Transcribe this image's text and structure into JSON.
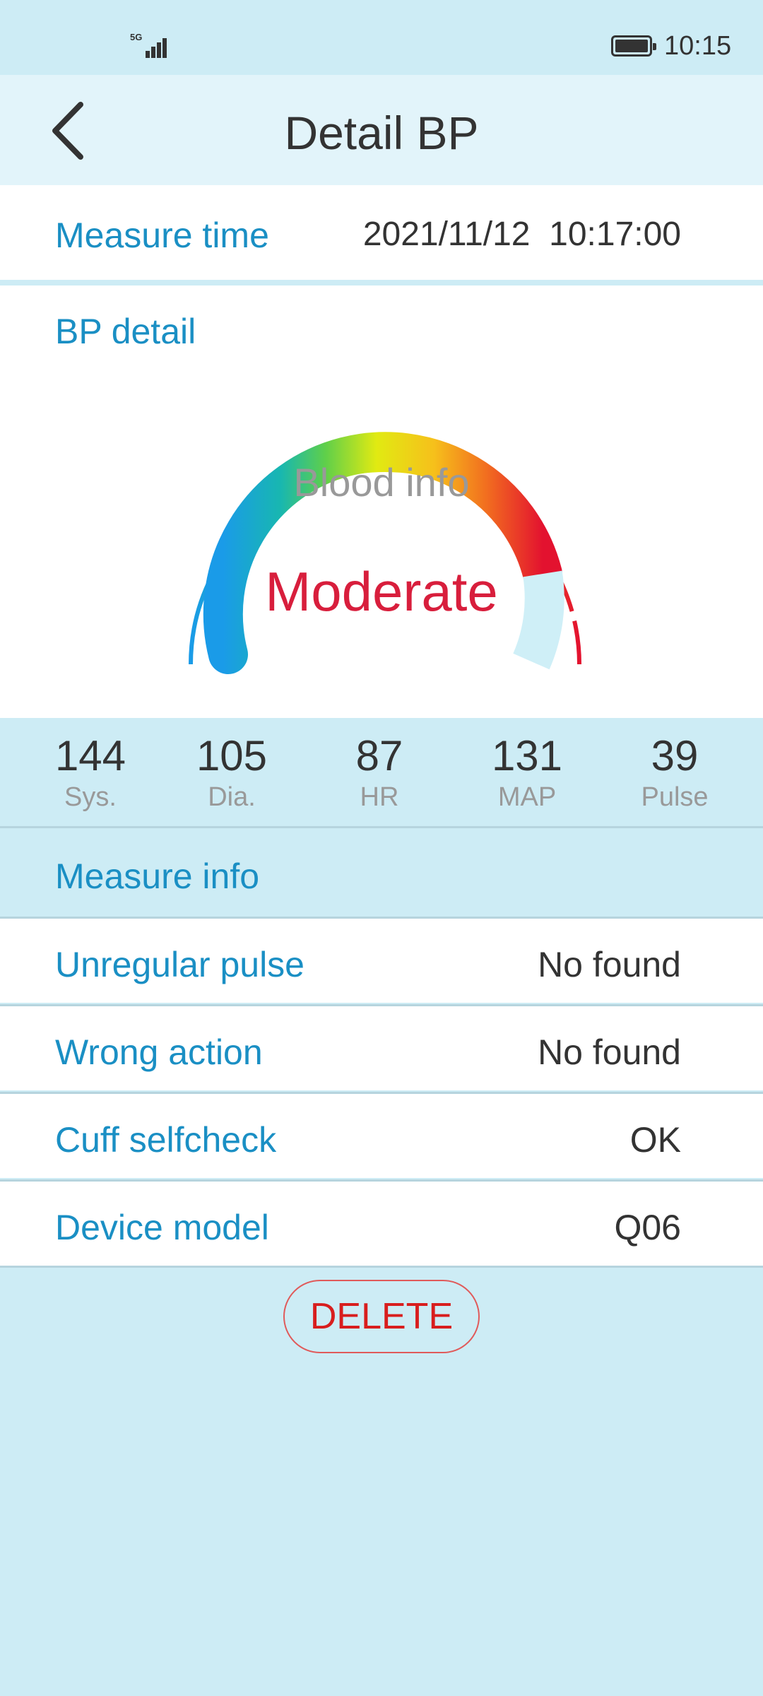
{
  "status_bar": {
    "network": "5G",
    "time": "10:15",
    "icons": [
      "signal-icon",
      "battery-icon"
    ]
  },
  "header": {
    "title": "Detail BP",
    "back_icon": "chevron-left-icon"
  },
  "measure_time": {
    "label": "Measure time",
    "value": "2021/11/12  10:17:00"
  },
  "bp_detail": {
    "label": "BP detail",
    "gauge_title": "Blood info",
    "status": "Moderate",
    "status_color": "#d81e3c"
  },
  "stats": [
    {
      "value": "144",
      "label": "Sys."
    },
    {
      "value": "105",
      "label": "Dia."
    },
    {
      "value": "87",
      "label": "HR"
    },
    {
      "value": "131",
      "label": "MAP"
    },
    {
      "value": "39",
      "label": "Pulse"
    }
  ],
  "measure_info": {
    "title": "Measure info",
    "rows": [
      {
        "label": "Unregular pulse",
        "value": "No found"
      },
      {
        "label": "Wrong action",
        "value": "No found"
      },
      {
        "label": "Cuff selfcheck",
        "value": "OK"
      },
      {
        "label": "Device model",
        "value": "Q06"
      }
    ]
  },
  "actions": {
    "delete_label": "DELETE"
  },
  "colors": {
    "accent_blue": "#1a8fc4",
    "background": "#cdecf5",
    "danger": "#d81e1e"
  }
}
